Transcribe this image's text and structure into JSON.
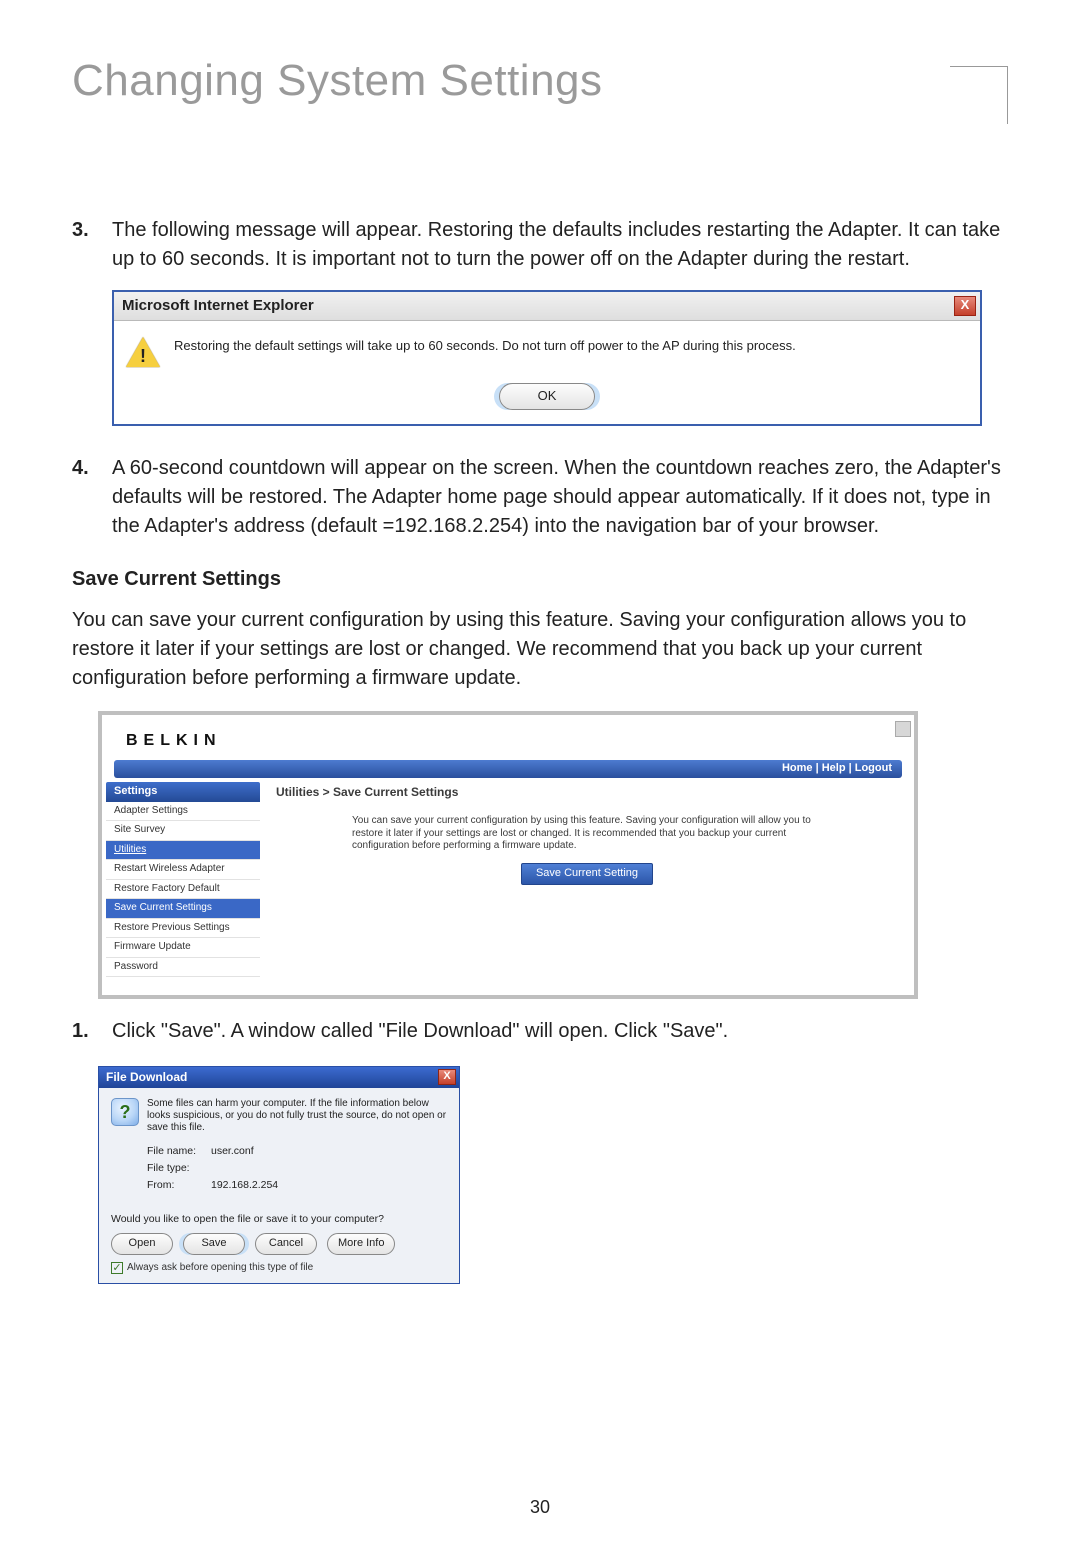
{
  "title": "Changing System Settings",
  "page_number": "30",
  "step3": {
    "num": "3.",
    "text": "The following message will appear. Restoring the defaults includes restarting the Adapter. It can take up to 60 seconds. It is important not to turn the power off on the Adapter during the restart."
  },
  "dialog_ie": {
    "title": "Microsoft Internet Explorer",
    "close": "X",
    "warning_glyph": "!",
    "message": "Restoring the default settings will take up to 60 seconds. Do not turn off power to the AP during this process.",
    "ok": "OK"
  },
  "step4": {
    "num": "4.",
    "text": "A 60-second countdown will appear on the screen. When the countdown reaches zero, the Adapter's defaults will be restored. The Adapter home page should appear automatically. If it does not, type in the Adapter's address (default =192.168.2.254) into the navigation bar of your browser."
  },
  "subheading": "Save Current Settings",
  "save_intro": "You can save your current configuration by using this feature. Saving your configuration allows you to restore it later if your settings are lost or changed. We recommend that you back up your current configuration before performing a firmware update.",
  "belkin": {
    "logo": "BELKIN",
    "nav": "Home | Help | Logout",
    "sidebar_header": "Settings",
    "items": [
      "Adapter Settings",
      "Site Survey",
      "Utilities",
      "Restart Wireless Adapter",
      "Restore Factory Default",
      "Save Current Settings",
      "Restore Previous Settings",
      "Firmware Update",
      "Password"
    ],
    "breadcrumb": "Utilities > Save Current Settings",
    "description": "You can save your current configuration by using this feature. Saving your configuration will allow you to restore it later if your settings are lost or changed. It is recommended that you backup your current configuration before performing a firmware update.",
    "button": "Save Current Setting"
  },
  "step1_after": {
    "num": "1.",
    "text": "Click \"Save\". A window called \"File Download\" will open. Click \"Save\"."
  },
  "file_download": {
    "title": "File Download",
    "close": "X",
    "q_glyph": "?",
    "warning": "Some files can harm your computer. If the file information below looks suspicious, or you do not fully trust the source, do not open or save this file.",
    "file_name_label": "File name:",
    "file_name": "user.conf",
    "file_type_label": "File type:",
    "file_type": "",
    "from_label": "From:",
    "from": "192.168.2.254",
    "prompt": "Would you like to open the file or save it to your computer?",
    "open": "Open",
    "save": "Save",
    "cancel": "Cancel",
    "more": "More Info",
    "checkbox_label": "Always ask before opening this type of file"
  }
}
